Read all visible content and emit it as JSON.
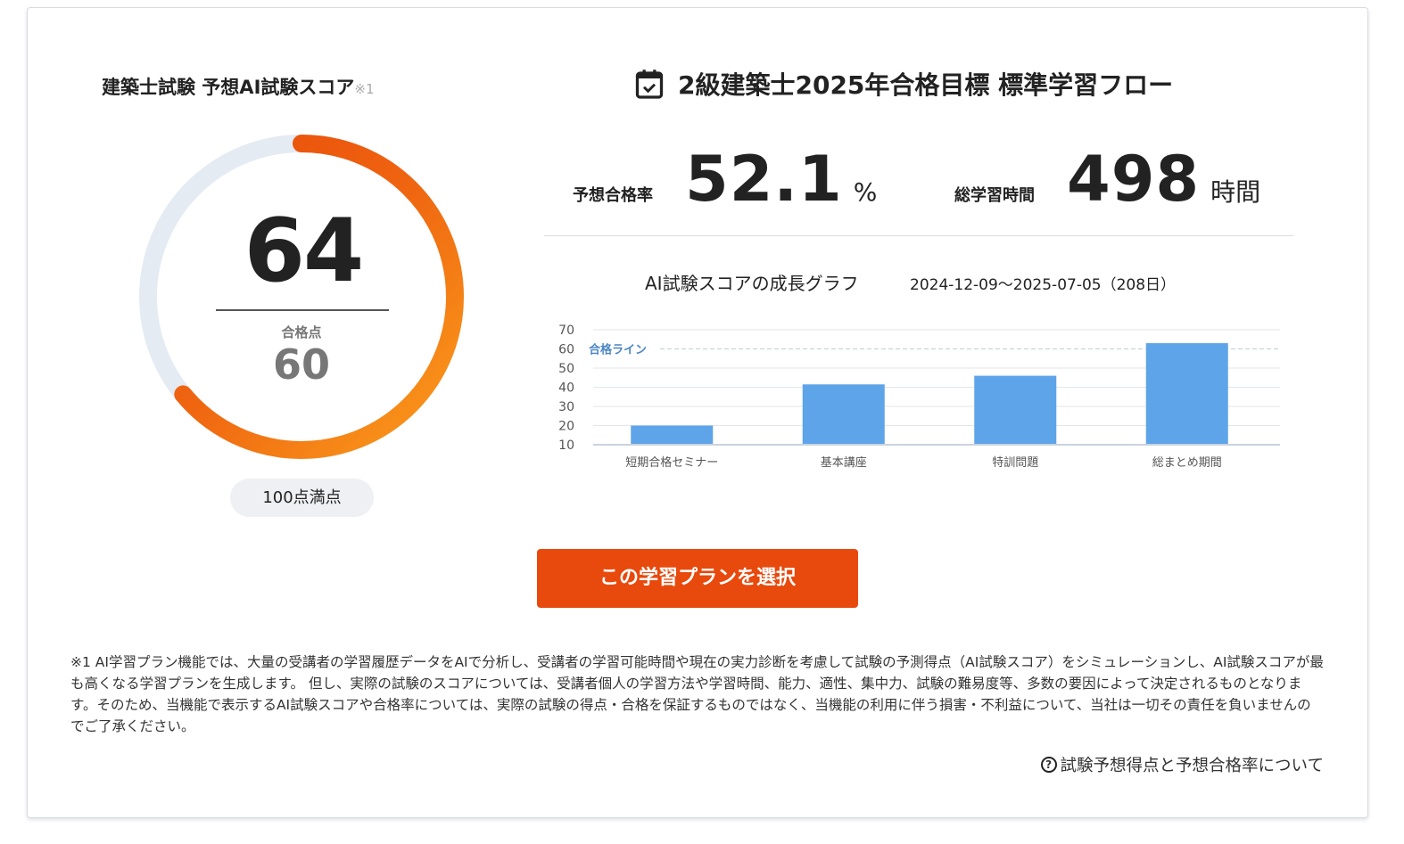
{
  "score_panel": {
    "title": "建築士試験 予想AI試験スコア",
    "note_mark": "※1",
    "score": "64",
    "score_value": 64,
    "score_max": 100,
    "pass_label": "合格点",
    "pass_value": "60",
    "full_marks": "100点満点"
  },
  "plan": {
    "title": "2級建築士2025年合格目標 標準学習フロー",
    "icon": "calendar-check-icon",
    "pass_rate_label": "予想合格率",
    "pass_rate": "52.1",
    "pass_rate_unit": "%",
    "hours_label": "総学習時間",
    "hours": "498",
    "hours_unit": "時間"
  },
  "chart_data": {
    "type": "bar",
    "title": "AI試験スコアの成長グラフ",
    "period": "2024-12-09〜2025-07-05（208日）",
    "categories": [
      "短期合格セミナー",
      "基本講座",
      "特訓問題",
      "総まとめ期間"
    ],
    "values": [
      20,
      41.5,
      46,
      63
    ],
    "ylim": [
      10,
      70
    ],
    "yticks": [
      "70",
      "60",
      "50",
      "40",
      "30",
      "20",
      "10"
    ],
    "reference_line": {
      "label": "合格ライン",
      "value": 60
    },
    "bar_color": "#5ea4e8"
  },
  "cta": {
    "label": "この学習プランを選択"
  },
  "footnote": "※1 AI学習プラン機能では、大量の受講者の学習履歴データをAIで分析し、受講者の学習可能時間や現在の実力診断を考慮して試験の予測得点（AI試験スコア）をシミュレーションし、AI試験スコアが最も高くなる学習プランを生成します。 但し、実際の試験のスコアについては、受講者個人の学習方法や学習時間、能力、適性、集中力、試験の難易度等、多数の要因によって決定されるものとなります。そのため、当機能で表示するAI試験スコアや合格率については、実際の試験の得点・合格を保証するものではなく、当機能の利用に伴う損害・不利益について、当社は一切その責任を負いませんのでご了承ください。",
  "help_link": "試験予想得点と予想合格率について"
}
